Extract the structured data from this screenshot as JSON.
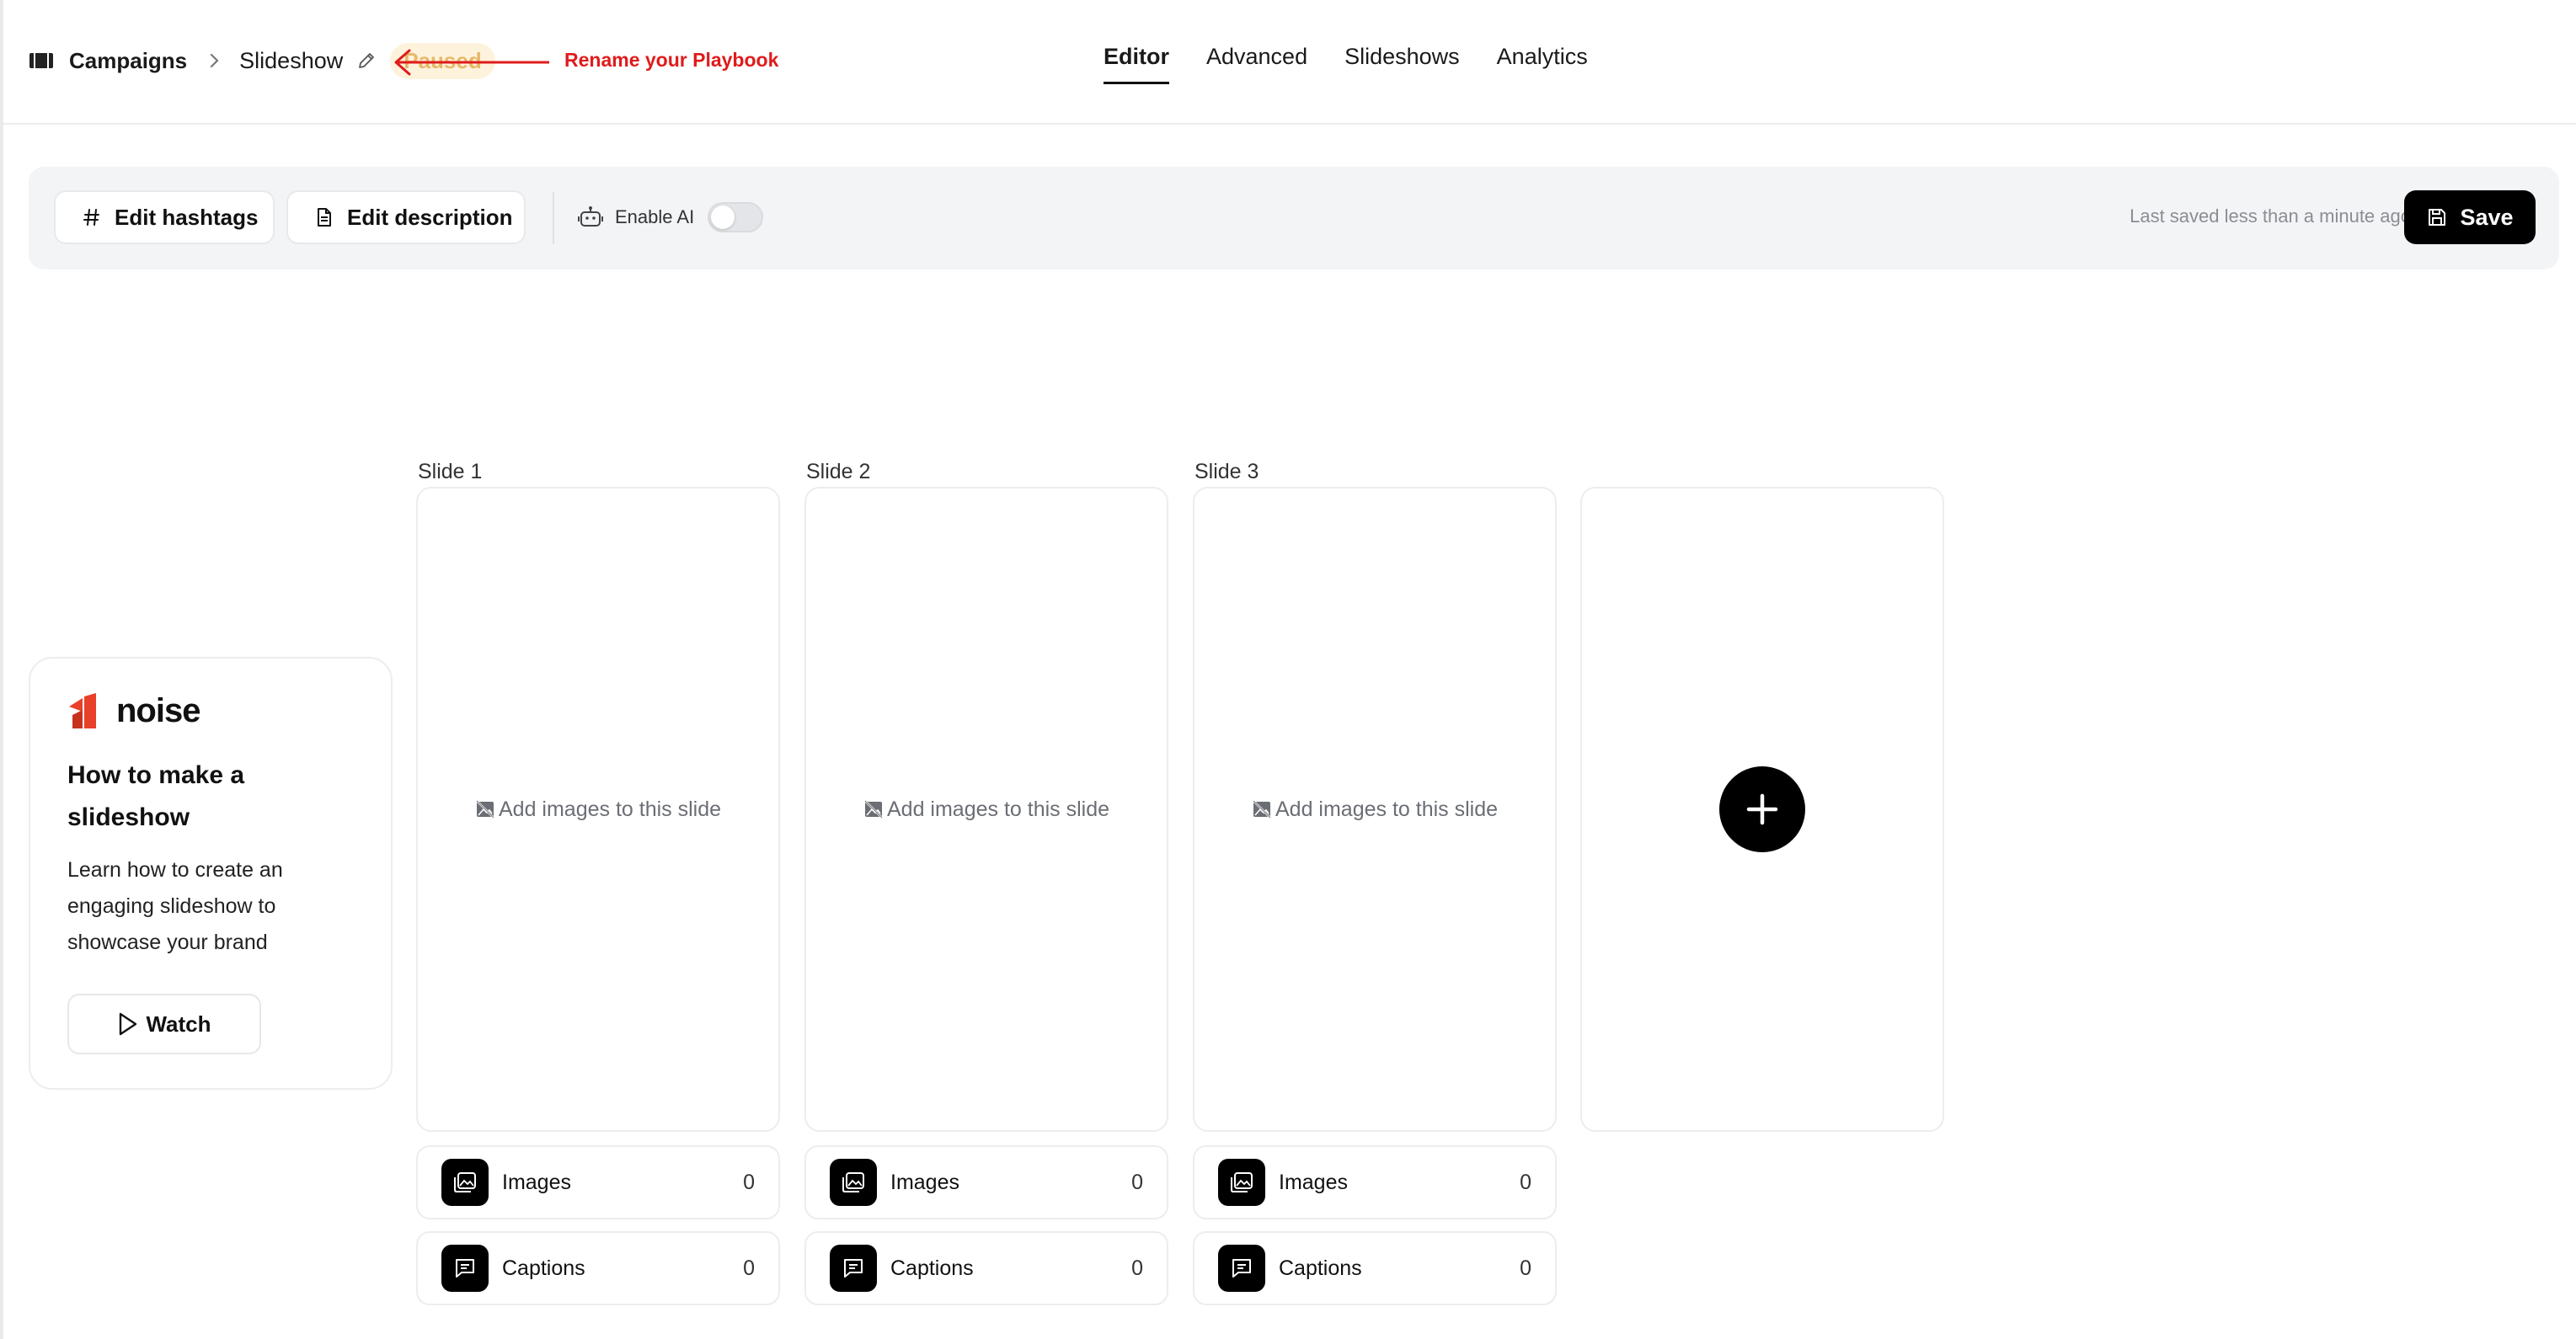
{
  "header": {
    "breadcrumb": {
      "root": "Campaigns",
      "current": "Slideshow",
      "status": "Paused"
    },
    "annotation": "Rename your Playbook",
    "tabs": [
      {
        "label": "Editor",
        "active": true
      },
      {
        "label": "Advanced",
        "active": false
      },
      {
        "label": "Slideshows",
        "active": false
      },
      {
        "label": "Analytics",
        "active": false
      }
    ]
  },
  "toolbar": {
    "edit_hashtags": "Edit hashtags",
    "edit_description": "Edit description",
    "enable_ai": "Enable AI",
    "enable_ai_on": false,
    "last_saved": "Last saved less than a minute ago",
    "save": "Save"
  },
  "tutorial": {
    "logo": "noise",
    "title": "How to make a slideshow",
    "description": "Learn how to create an engaging slideshow to showcase your brand",
    "watch": "Watch"
  },
  "slides": [
    {
      "label": "Slide 1",
      "empty_text": "Add images to this slide",
      "images_label": "Images",
      "images_count": "0",
      "captions_label": "Captions",
      "captions_count": "0"
    },
    {
      "label": "Slide 2",
      "empty_text": "Add images to this slide",
      "images_label": "Images",
      "images_count": "0",
      "captions_label": "Captions",
      "captions_count": "0"
    },
    {
      "label": "Slide 3",
      "empty_text": "Add images to this slide",
      "images_label": "Images",
      "images_count": "0",
      "captions_label": "Captions",
      "captions_count": "0"
    }
  ],
  "colors": {
    "accent": "#000000",
    "annotation": "#e01b1b",
    "status_bg": "#fdf3dc",
    "status_text": "#e8b86a",
    "logo_mark": "#e8402a"
  }
}
